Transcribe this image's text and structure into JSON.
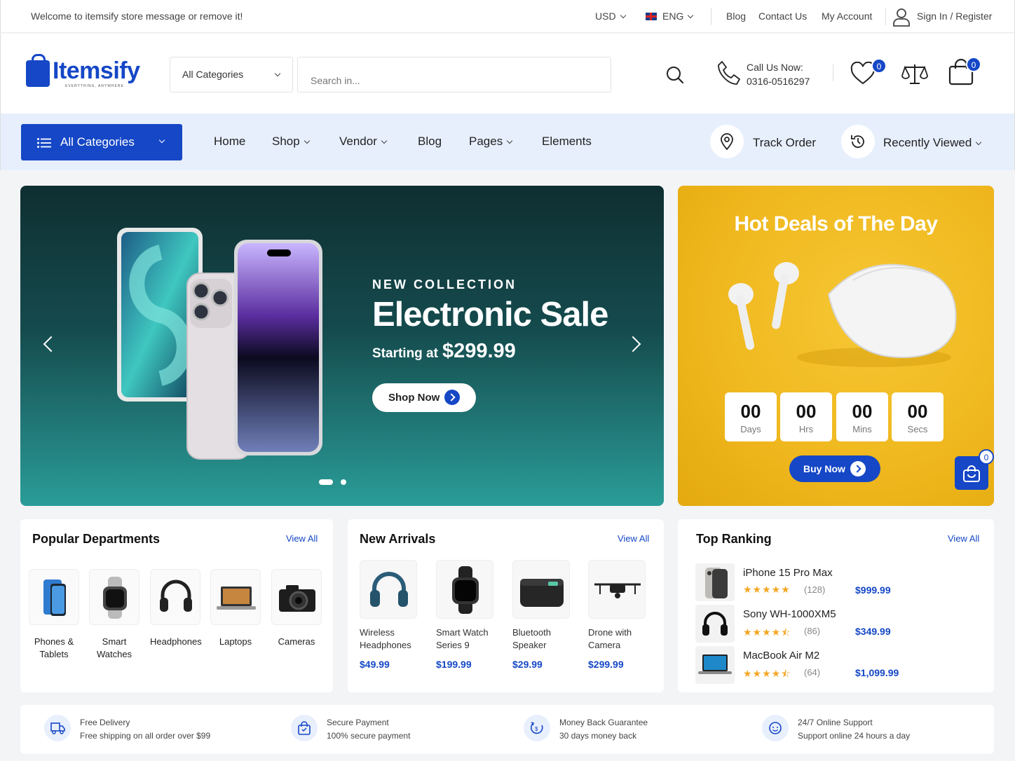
{
  "topbar": {
    "welcome": "Welcome to itemsify store message or remove it!",
    "currency": "USD",
    "language": "ENG",
    "links": [
      "Blog",
      "Contact Us",
      "My Account"
    ],
    "signin": "Sign In / Register"
  },
  "header": {
    "brand": "Itemsify",
    "tagline": "EVERYTHING, ANYWHERE",
    "category_select": "All Categories",
    "search_placeholder": "Search in...",
    "call_label": "Call Us Now:",
    "call_number": "0316-0516297",
    "wishlist_count": "0",
    "cart_count": "0"
  },
  "nav": {
    "all_categories": "All Categories",
    "items": [
      "Home",
      "Shop",
      "Vendor",
      "Blog",
      "Pages",
      "Elements"
    ],
    "track_order": "Track Order",
    "recently_viewed": "Recently Viewed"
  },
  "hero": {
    "subtitle": "NEW COLLECTION",
    "title": "Electronic Sale",
    "price_prefix": "Starting at",
    "price": "$299.99",
    "button": "Shop Now"
  },
  "deals": {
    "title": "Hot Deals of The Day",
    "countdown": [
      {
        "value": "00",
        "unit": "Days"
      },
      {
        "value": "00",
        "unit": "Hrs"
      },
      {
        "value": "00",
        "unit": "Mins"
      },
      {
        "value": "00",
        "unit": "Secs"
      }
    ],
    "button": "Buy Now",
    "floating_cart_count": "0"
  },
  "popular": {
    "title": "Popular Departments",
    "view_all": "View All",
    "items": [
      {
        "line1": "Phones &",
        "line2": "Tablets"
      },
      {
        "line1": "Smart",
        "line2": "Watches"
      },
      {
        "line1": "Headphones",
        "line2": ""
      },
      {
        "line1": "Laptops",
        "line2": ""
      },
      {
        "line1": "Cameras",
        "line2": ""
      }
    ]
  },
  "arrivals": {
    "title": "New Arrivals",
    "view_all": "View All",
    "items": [
      {
        "line1": "Wireless",
        "line2": "Headphones",
        "price": "$49.99"
      },
      {
        "line1": "Smart Watch",
        "line2": "Series 9",
        "price": "$199.99"
      },
      {
        "line1": "Bluetooth",
        "line2": "Speaker",
        "price": "$29.99"
      },
      {
        "line1": "Drone with",
        "line2": "Camera",
        "price": "$299.99"
      }
    ]
  },
  "ranking": {
    "title": "Top Ranking",
    "view_all": "View All",
    "items": [
      {
        "name": "iPhone 15 Pro Max",
        "rating": 5,
        "stars": "★★★★★",
        "count": "(128)",
        "price": "$999.99"
      },
      {
        "name": "Sony WH-1000XM5",
        "rating": 4.5,
        "stars": "★★★★⯪",
        "count": "(86)",
        "price": "$349.99"
      },
      {
        "name": "MacBook Air M2",
        "rating": 4.5,
        "stars": "★★★★⯪",
        "count": "(64)",
        "price": "$1,099.99"
      }
    ]
  },
  "features": [
    {
      "icon": "truck-icon",
      "title": "Free Delivery",
      "sub": "Free shipping on all order over $99"
    },
    {
      "icon": "secure-bag-icon",
      "title": "Secure Payment",
      "sub": "100% secure payment"
    },
    {
      "icon": "money-back-icon",
      "title": "Money Back Guarantee",
      "sub": "30 days money back"
    },
    {
      "icon": "support-icon",
      "title": "24/7 Online Support",
      "sub": "Support online 24 hours a day"
    }
  ],
  "colors": {
    "brand": "#1547c6",
    "nav_bg": "#e7effd",
    "hero_bg": "#154b4e",
    "deals_bg": "#efb71d",
    "stars": "#f5a623"
  }
}
